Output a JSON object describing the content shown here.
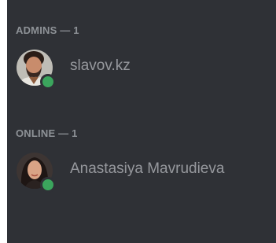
{
  "groups": [
    {
      "header": "ADMINS — 1",
      "members": [
        {
          "name": "slavov.kz",
          "status": "online",
          "status_color": "#3ba55d"
        }
      ]
    },
    {
      "header": "ONLINE — 1",
      "members": [
        {
          "name": "Anastasiya Mavrudieva",
          "status": "online",
          "status_color": "#3ba55d"
        }
      ]
    }
  ]
}
